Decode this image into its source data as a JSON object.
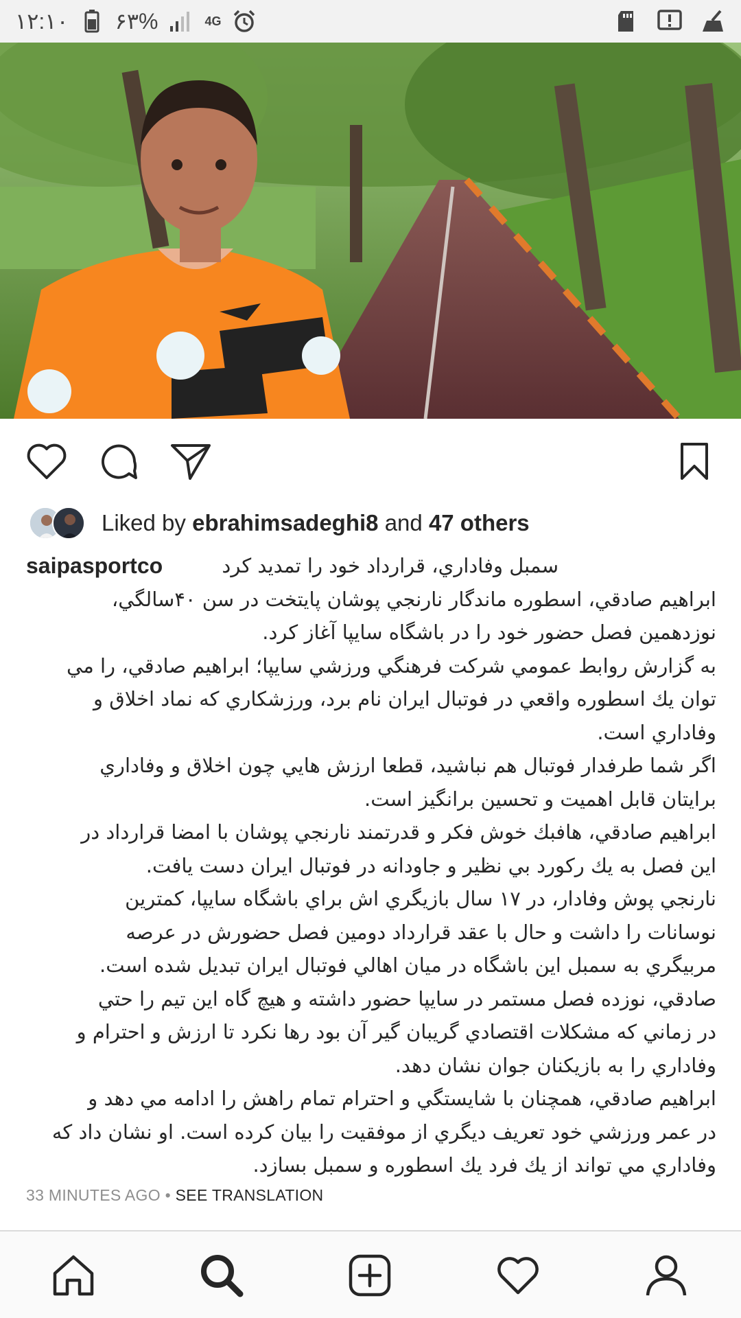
{
  "status_bar": {
    "time": "۱۲:۱۰",
    "battery": "۶۳%",
    "network": "4G"
  },
  "icons": {
    "photo": "post-photo",
    "like": "heart-icon",
    "comment": "comment-icon",
    "share": "send-icon",
    "save": "bookmark-icon",
    "home": "home-icon",
    "search": "search-icon",
    "add": "add-post-icon",
    "activity": "heart-icon",
    "profile": "profile-icon"
  },
  "likes": {
    "prefix": "Liked by",
    "user": "ebrahimsadeghi8",
    "and": "and",
    "others": "47 others"
  },
  "caption": {
    "username": "saipasportco",
    "headline": "سمبل وفاداري، قرارداد خود را تمديد كرد",
    "lines": [
      "ابراهيم صادقي، اسطوره ماندگار نارنجي پوشان پايتخت در سن ۴۰سالگي،",
      "نوزدهمين فصل حضور خود را در باشگاه سايپا آغاز كرد.",
      "به گزارش روابط عمومي شركت فرهنگي ورزشي سايپا؛ ابراهيم صادقي، را مي",
      "توان يك اسطوره واقعي در فوتبال ايران نام برد، ورزشكاري كه نماد اخلاق و",
      "وفاداري است.",
      "اگر شما طرفدار فوتبال هم نباشيد، قطعا ارزش هايي چون اخلاق و وفاداري",
      "برايتان قابل اهميت و تحسين برانگيز است.",
      "ابراهيم صادقي، هافبك خوش فكر و قدرتمند نارنجي پوشان با امضا قرارداد در",
      "اين فصل به يك ركورد بي نظير و جاودانه در فوتبال ايران دست يافت.",
      "نارنجي پوش وفادار، در ۱۷ سال بازيگري اش براي باشگاه سايپا، كمترين",
      "نوسانات را داشت و حال با عقد قرارداد دومين فصل حضورش در عرصه",
      "مربيگري به سمبل اين باشگاه در ميان اهالي فوتبال ايران تبديل شده است.",
      "صادقي، نوزده فصل مستمر در سايپا حضور داشته و هيچ گاه اين تيم را حتي",
      "در زماني كه مشكلات اقتصادي گريبان گير آن بود رها نكرد تا ارزش و احترام و",
      "وفاداري را به بازيكنان جوان نشان دهد.",
      "ابراهيم صادقي، همچنان با شايستگي و احترام تمام راهش را ادامه مي دهد و",
      "در عمر ورزشي خود تعريف ديگري از موفقيت را بيان كرده است. او نشان داد كه",
      "وفاداري مي تواند از يك فرد يك اسطوره و سمبل بسازد."
    ]
  },
  "meta": {
    "time_ago": "33 MINUTES AGO",
    "separator": " • ",
    "translation": "SEE TRANSLATION"
  },
  "colors": {
    "text": "#262626",
    "muted": "#8e8e8e",
    "jersey": "#f7861f"
  }
}
